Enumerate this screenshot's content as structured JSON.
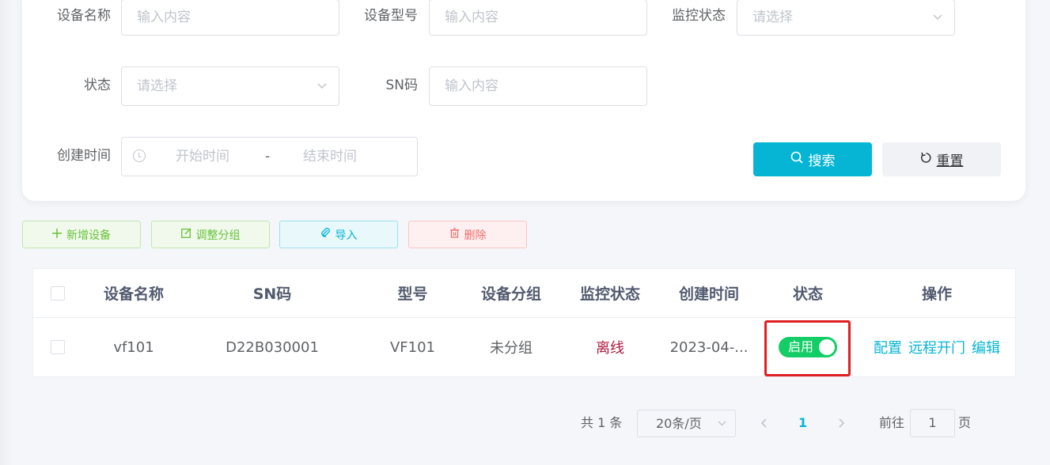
{
  "form": {
    "device_name_label": "设备名称",
    "device_name_placeholder": "输入内容",
    "device_model_label": "设备型号",
    "device_model_placeholder": "输入内容",
    "monitor_status_label": "监控状态",
    "monitor_status_placeholder": "请选择",
    "status_label": "状态",
    "status_placeholder": "请选择",
    "sn_label": "SN码",
    "sn_placeholder": "输入内容",
    "create_time_label": "创建时间",
    "start_placeholder": "开始时间",
    "range_separator": "-",
    "end_placeholder": "结束时间",
    "search_label": "搜索",
    "reset_label": "重置"
  },
  "toolbar": {
    "add_label": "新增设备",
    "group_label": "调整分组",
    "import_label": "导入",
    "delete_label": "删除"
  },
  "table": {
    "headers": [
      "设备名称",
      "SN码",
      "型号",
      "设备分组",
      "监控状态",
      "创建时间",
      "状态",
      "操作"
    ],
    "rows": [
      {
        "name": "vf101",
        "sn": "D22B030001",
        "model": "VF101",
        "group": "未分组",
        "monitor": "离线",
        "created": "2023-04-...",
        "status": "启用",
        "actions": [
          "配置",
          "远程开门",
          "编辑"
        ]
      }
    ]
  },
  "pagination": {
    "total": "共 1 条",
    "page_size": "20条/页",
    "current": "1",
    "goto_label": "前往",
    "goto_value": "1",
    "page_suffix": "页"
  },
  "colors": {
    "accent": "#06b5d4",
    "switch_on": "#13ce66",
    "offline": "#b01a3f",
    "highlight": "#e02020"
  }
}
